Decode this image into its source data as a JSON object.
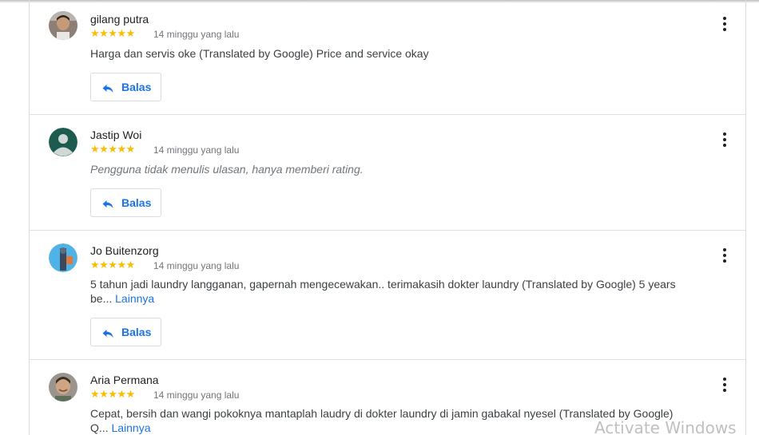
{
  "reviews": [
    {
      "name": "gilang putra",
      "stars": "★★★★★",
      "time": "14 minggu yang lalu",
      "text": "Harga dan servis oke (Translated by Google) Price and service okay",
      "reply_label": "Balas",
      "avatar": "photo-avatar-young-man"
    },
    {
      "name": "Jastip Woi",
      "stars": "★★★★★",
      "time": "14 minggu yang lalu",
      "text": "Pengguna tidak menulis ulasan, hanya memberi rating.",
      "reply_label": "Balas",
      "avatar": "default-person-avatar"
    },
    {
      "name": "Jo Buitenzorg",
      "stars": "★★★★★",
      "time": "14 minggu yang lalu",
      "text": "5 tahun jadi laundry langganan, gapernah mengecewakan.. terimakasih dokter laundry (Translated by Google) 5 years be...",
      "more_label": "Lainnya",
      "reply_label": "Balas",
      "avatar": "photo-avatar-statue"
    },
    {
      "name": "Aria Permana",
      "stars": "★★★★★",
      "time": "14 minggu yang lalu",
      "text": "Cepat, bersih dan wangi pokoknya mantaplah laudry di dokter laundry di jamin gabakal nyesel (Translated by Google) Q...",
      "more_label": "Lainnya",
      "avatar": "photo-avatar-smiling-man"
    }
  ],
  "watermark": "Activate Windows",
  "colors": {
    "star": "#fbbc04",
    "link": "#1a73e8",
    "default_avatar_bg": "#1e5b4f"
  },
  "icons": {
    "menu": "more-vert-icon",
    "reply": "reply-arrow-icon"
  }
}
